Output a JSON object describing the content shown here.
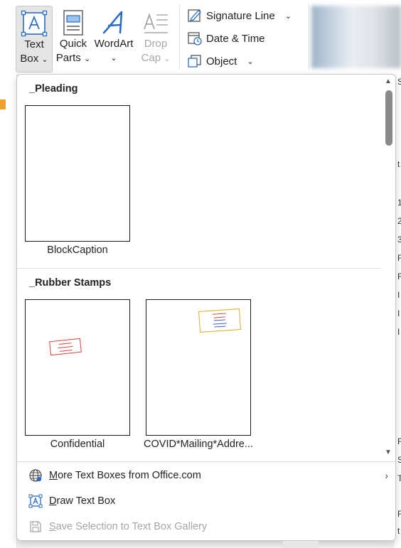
{
  "ribbon": {
    "text_box": {
      "line1": "Text",
      "line2": "Box",
      "chev": "⌄"
    },
    "quick_parts": {
      "line1": "Quick",
      "line2": "Parts",
      "chev": "⌄"
    },
    "wordart": {
      "line1": "WordArt",
      "chev": "⌄"
    },
    "drop_cap": {
      "line1": "Drop",
      "line2": "Cap",
      "chev": "⌄"
    },
    "signature_line": {
      "label": "Signature Line",
      "chev": "⌄"
    },
    "date_time": {
      "label": "Date & Time"
    },
    "object": {
      "label": "Object",
      "chev": "⌄"
    }
  },
  "gallery": {
    "sections": [
      {
        "title": "_Pleading",
        "items": [
          {
            "caption": "BlockCaption"
          }
        ]
      },
      {
        "title": "_Rubber Stamps",
        "items": [
          {
            "caption": "Confidential"
          },
          {
            "caption": "COVID*Mailing*Addre..."
          }
        ]
      }
    ]
  },
  "menu": {
    "more": {
      "underline": "M",
      "rest": "ore Text Boxes from Office.com"
    },
    "draw": {
      "underline": "D",
      "rest": "raw Text Box"
    },
    "save": {
      "underline": "S",
      "rest": "ave Selection to Text Box Gallery"
    }
  },
  "doc_right_letters": [
    "S",
    "t",
    "1",
    "2",
    "3",
    "F",
    "F",
    "I",
    "I",
    "I",
    "F",
    "S",
    "T",
    "F",
    "t"
  ],
  "colors": {
    "accent": "#2b6cc4",
    "disabled": "#a6a6a6",
    "stamp_red": "#e04040",
    "stamp_gold": "#e0b020"
  }
}
